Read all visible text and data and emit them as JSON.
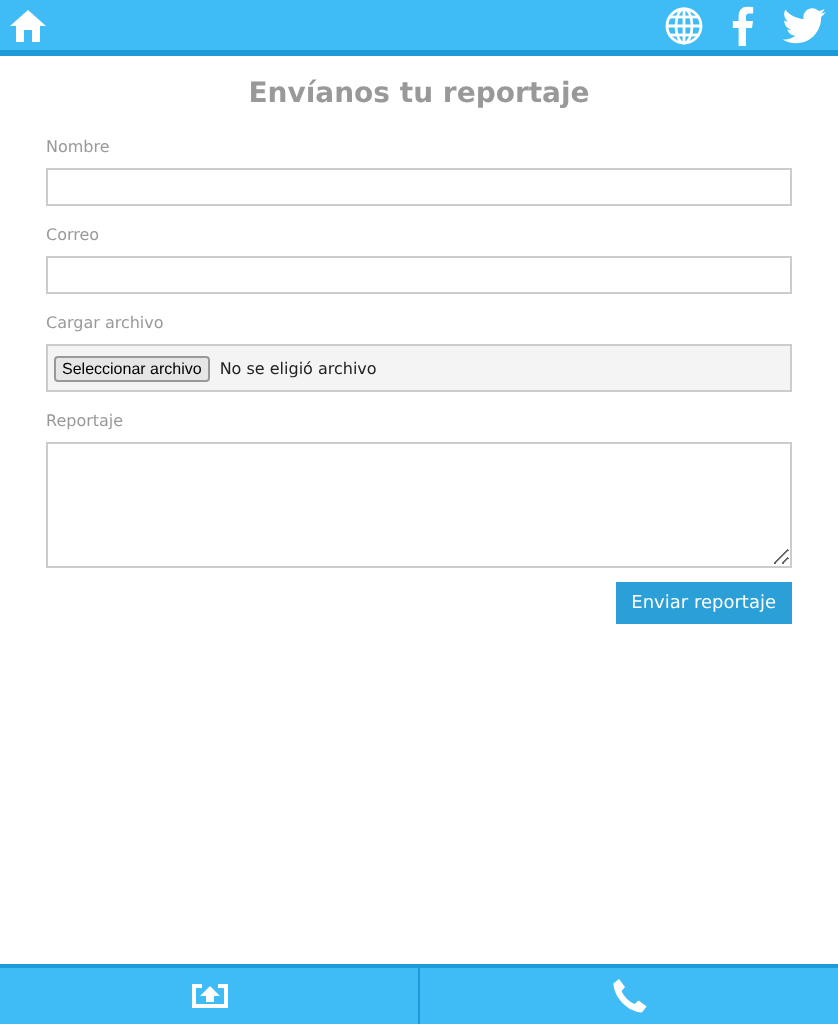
{
  "title": "Envíanos tu reportaje",
  "fields": [
    {
      "kind": "text",
      "label": "Nombre"
    },
    {
      "kind": "text",
      "label": "Correo"
    },
    {
      "kind": "file",
      "label": "Cargar archivo",
      "button": "Seleccionar archivo",
      "status": "No se eligió archivo"
    },
    {
      "kind": "textarea",
      "label": "Reportaje"
    }
  ],
  "submit": "Enviar reportaje"
}
